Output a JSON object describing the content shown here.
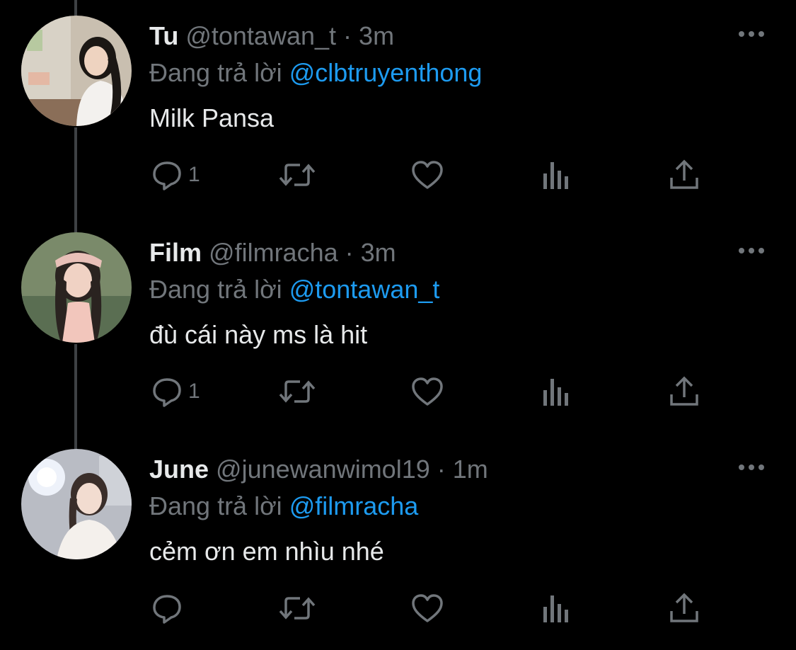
{
  "tweets": [
    {
      "name": "Tu",
      "handle": "@tontawan_t",
      "sep": "·",
      "time": "3m",
      "reply_prefix": "Đang trả lời",
      "reply_to": "@clbtruyenthong",
      "text": "Milk Pansa",
      "reply_count": "1"
    },
    {
      "name": "Film",
      "handle": "@filmracha",
      "sep": "·",
      "time": "3m",
      "reply_prefix": "Đang trả lời",
      "reply_to": "@tontawan_t",
      "text": "đù cái này ms là hit",
      "reply_count": "1"
    },
    {
      "name": "June",
      "handle": "@junewanwimol19",
      "sep": "·",
      "time": "1m",
      "reply_prefix": "Đang trả lời",
      "reply_to": "@filmracha",
      "text": "cẻm ơn em nhìu nhé",
      "reply_count": ""
    }
  ],
  "icons": {
    "more": "more-horizontal-icon",
    "reply": "reply-bubble-icon",
    "retweet": "retweet-icon",
    "like": "heart-icon",
    "views": "analytics-icon",
    "share": "share-icon"
  },
  "colors": {
    "background": "#000000",
    "text": "#e7e9ea",
    "muted": "#71767b",
    "mention": "#1d9bf0",
    "thread_line": "#3e4144"
  }
}
